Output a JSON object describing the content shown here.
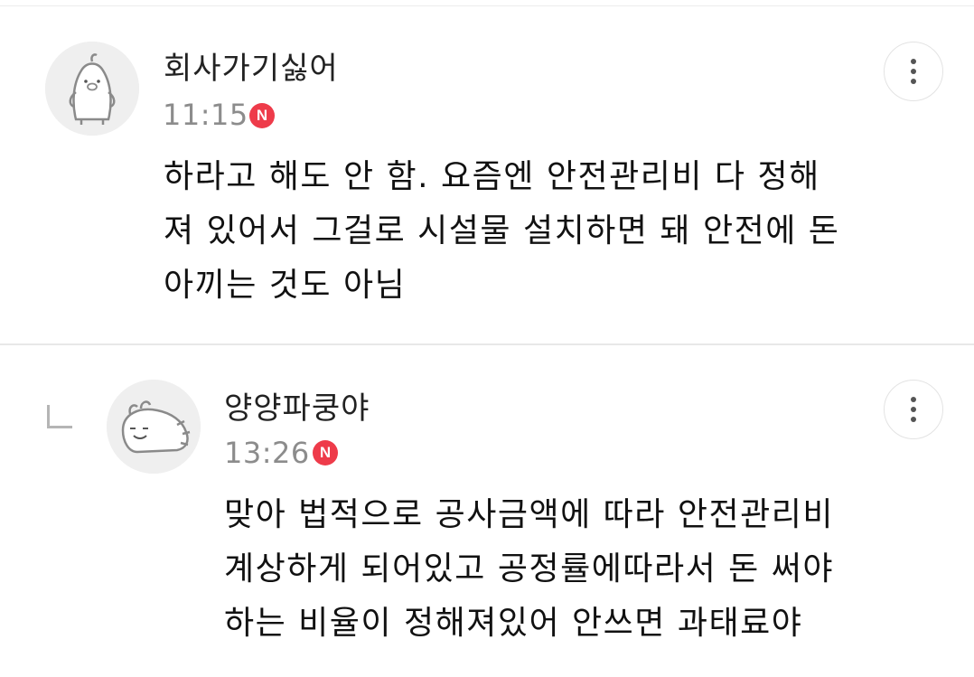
{
  "comments": [
    {
      "author": "회사가기싫어",
      "time": "11:15",
      "badge": "N",
      "lines": [
        "하라고 해도 안 함. 요즘엔 안전관리비 다 정해",
        "져 있어서 그걸로 시설물 설치하면 돼 안전에 돈",
        "아끼는 것도 아님"
      ],
      "avatar_icon": "penguin-avatar-icon",
      "more_icon": "more-vertical-icon"
    },
    {
      "author": "양양파쿵야",
      "time": "13:26",
      "badge": "N",
      "lines": [
        "맞아 법적으로 공사금액에 따라 안전관리비",
        "계상하게 되어있고 공정률에따라서 돈 써야",
        "하는 비율이 정해져있어 안쓰면 과태료야"
      ],
      "avatar_icon": "onion-creature-avatar-icon",
      "more_icon": "more-vertical-icon",
      "is_reply": true,
      "reply_icon": "reply-arrow-icon"
    }
  ],
  "colors": {
    "badge": "#ee3b4a",
    "time": "#8c8c8c",
    "divider": "#e8e8e8",
    "avatar_bg": "#efefef"
  }
}
